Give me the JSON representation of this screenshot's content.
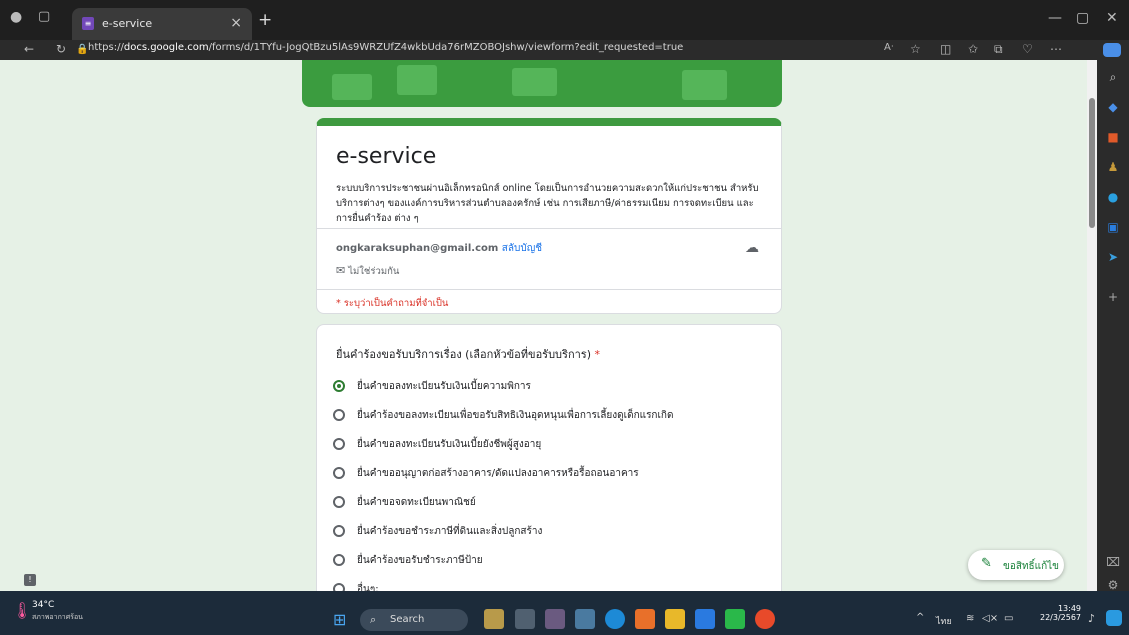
{
  "browser": {
    "tab_title": "e-service",
    "new_tab": "+",
    "url_prefix": "https://",
    "url_domain": "docs.google.com",
    "url_path": "/forms/d/1TYfu-JogQtBzu5lAs9WRZUfZ4wkbUda76rMZOBOJshw/viewform?edit_requested=true",
    "window_controls": [
      "—",
      "▢",
      "✕"
    ]
  },
  "form": {
    "title": "e-service",
    "description": "ระบบบริการประชาชนผ่านอิเล็กทรอนิกส์ online โดยเป็นการอำนวยความสะดวกให้แก่ประชาชน สำหรับบริการต่างๆ ของแงค์การบริหารส่วนตำบลองครักษ์ เช่น การเสียภาษี/ค่าธรรมเนียม การจดทะเบียน และการยื่นคำร้อง ต่าง ๆ",
    "account_email": "ongkaraksuphan@gmail.com",
    "switch_account": "สลับบัญชี",
    "not_shared": "ไม่ใช่ร่วมกัน",
    "required_note": "* ระบุว่าเป็นคำถามที่จำเป็น"
  },
  "question": {
    "title": "ยื่นคำร้องขอรับบริการเรื่อง (เลือกหัวข้อที่ขอรับบริการ)",
    "required_star": "*",
    "options": [
      "ยื่นคำขอลงทะเบียนรับเงินเบี้ยความพิการ",
      "ยื่นคำร้องขอลงทะเบียนเพื่อขอรับสิทธิเงินอุดหนุนเพื่อการเลี้ยงดูเด็กแรกเกิด",
      "ยื่นคำขอลงทะเบียนรับเงินเบี้ยยังชีพผู้สูงอายุ",
      "ยื่นคำขออนุญาตก่อสร้างอาคาร/ดัดแปลงอาคารหรือรื้อถอนอาคาร",
      "ยื่นคำขอจดทะเบียนพาณิชย์",
      "ยื่นคำร้องขอชำระภาษีที่ดินและสิ่งปลูกสร้าง",
      "ยื่นคำร้องขอรับชำระภาษีป้าย",
      "อื่นๆ:"
    ],
    "selected_index": 0
  },
  "edit_button": "ขอสิทธิ์แก้ไข",
  "taskbar": {
    "temperature": "34°C",
    "weather_desc": "สภาพอากาศร้อน",
    "search": "Search",
    "lang": "ไทย",
    "time": "13:49",
    "date": "22/3/2567"
  },
  "colors": {
    "accent_green": "#3e9a40",
    "required_red": "#d93025",
    "link_blue": "#1a73e8"
  }
}
